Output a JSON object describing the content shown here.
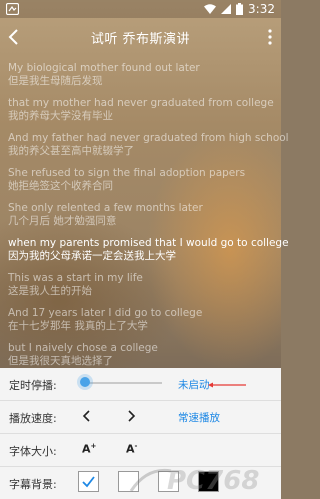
{
  "status_bar": {
    "time": "3:32"
  },
  "header": {
    "title": "试听 乔布斯演讲"
  },
  "lyrics": [
    {
      "en": "My biological mother found out later",
      "zh": "但是我生母随后发现",
      "active": false
    },
    {
      "en": "that my mother had never graduated from college",
      "zh": "我的养母大学没有毕业",
      "active": false
    },
    {
      "en": "And my father had never graduated from high school",
      "zh": "我的养父甚至高中就辍学了",
      "active": false
    },
    {
      "en": "She refused to sign the final adoption papers",
      "zh": "她拒绝签这个收养合同",
      "active": false
    },
    {
      "en": "She only relented a few months later",
      "zh": "几个月后 她才勉强同意",
      "active": false
    },
    {
      "en": "when my parents promised that I would go to college",
      "zh": "因为我的父母承诺一定会送我上大学",
      "active": true
    },
    {
      "en": "This was a start in my life",
      "zh": "这是我人生的开始",
      "active": false
    },
    {
      "en": "And 17 years later I did go to college",
      "zh": "在十七岁那年 我真的上了大学",
      "active": false
    },
    {
      "en": "but I naively chose a college",
      "zh": "但是我很天真地选择了",
      "active": false
    }
  ],
  "settings": {
    "timer": {
      "label": "定时停播:",
      "value_text": "未启动",
      "level": 0
    },
    "speed": {
      "label": "播放速度:",
      "value_text": "常速播放"
    },
    "font_size": {
      "label": "字体大小:",
      "increase": "A",
      "increase_sup": "+",
      "decrease": "A",
      "decrease_sup": "-"
    },
    "subtitle_bg": {
      "label": "字幕背景:",
      "options": [
        "white",
        "white",
        "white",
        "black"
      ],
      "selected": 0
    }
  },
  "colors": {
    "accent": "#1e88e5",
    "arrow": "#e53935"
  }
}
